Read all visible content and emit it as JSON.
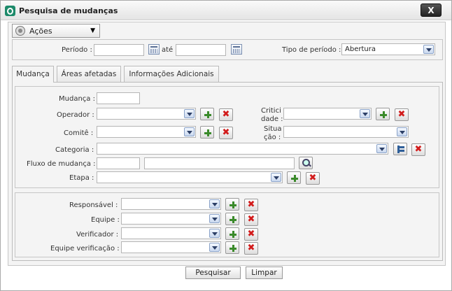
{
  "window": {
    "title": "Pesquisa de mudanças",
    "close_label": "X"
  },
  "toolbar": {
    "acoes_label": "Ações"
  },
  "period": {
    "periodo_label": "Período :",
    "ate_label": "até",
    "start_value": "",
    "end_value": "",
    "tipo_label": "Tipo de período :",
    "tipo_value": "Abertura"
  },
  "tabs": [
    {
      "label": "Mudança"
    },
    {
      "label": "Áreas afetadas"
    },
    {
      "label": "Informações Adicionais"
    }
  ],
  "form": {
    "mudanca_label": "Mudança :",
    "operador_label": "Operador :",
    "comite_label": "Comitê :",
    "criticidade_label_1": "Critici",
    "criticidade_label_2": "dade :",
    "situacao_label_1": "Situa",
    "situacao_label_2": "ção :",
    "categoria_label": "Categoria :",
    "fluxo_label": "Fluxo de mudança :",
    "etapa_label": "Etapa :"
  },
  "roles": {
    "responsavel_label": "Responsável :",
    "equipe_label": "Equipe :",
    "verificador_label": "Verificador :",
    "equipe_verificacao_label": "Equipe verificação :"
  },
  "buttons": {
    "pesquisar": "Pesquisar",
    "limpar": "Limpar"
  },
  "colors": {
    "add": "#3a8a2a",
    "delete": "#d21c1c",
    "logo": "#1d8a6a"
  }
}
